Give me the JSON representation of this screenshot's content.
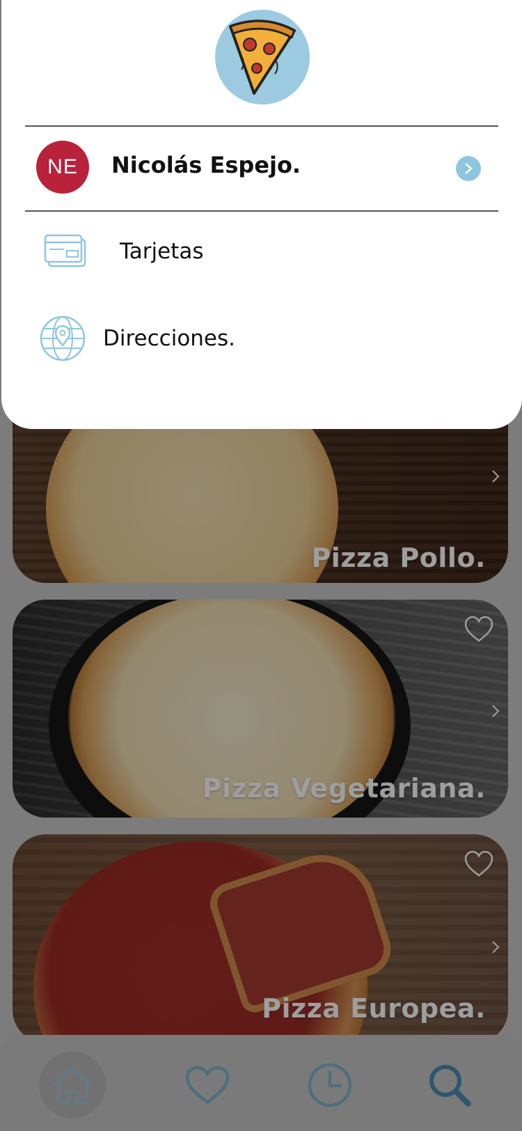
{
  "cards": [
    {
      "title": "Pizza Pollo."
    },
    {
      "title": "Pizza Vegetariana."
    },
    {
      "title": "Pizza Europea."
    }
  ],
  "drawer": {
    "user": {
      "initials": "NE",
      "name": "Nicolás Espejo."
    },
    "menu": [
      {
        "label": "Tarjetas",
        "icon": "credit-card-icon"
      },
      {
        "label": "Direcciones.",
        "icon": "globe-location-icon"
      }
    ]
  },
  "bottom_nav": [
    {
      "icon": "home-icon",
      "active": true
    },
    {
      "icon": "heart-icon"
    },
    {
      "icon": "clock-icon"
    },
    {
      "icon": "search-icon"
    }
  ],
  "colors": {
    "accent": "#8ec6df",
    "avatar_bg": "#b8223b",
    "logo_bg": "#9ccae0"
  }
}
